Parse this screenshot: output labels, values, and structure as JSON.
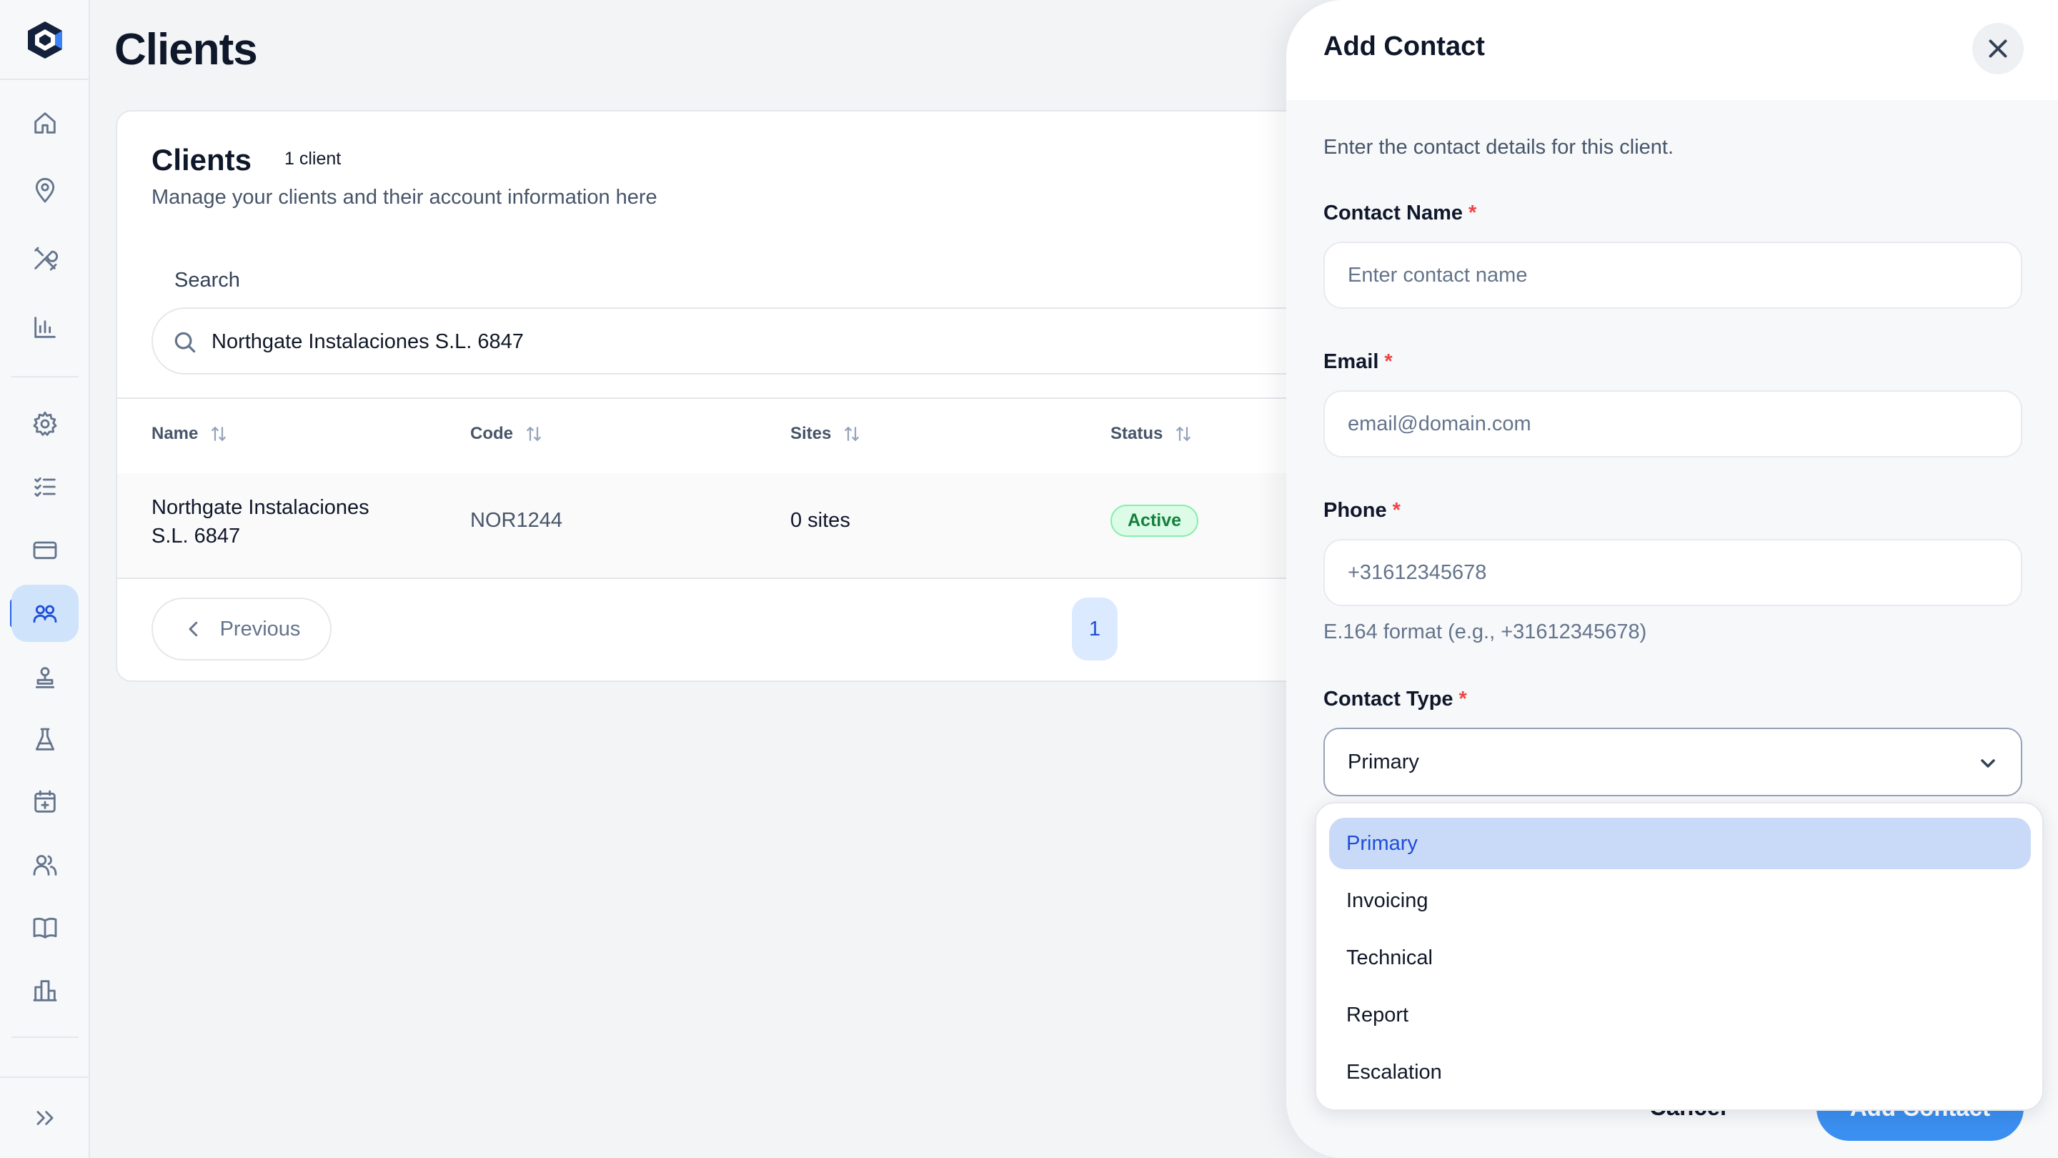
{
  "sidebar": {
    "icons": [
      "home-icon",
      "map-pin-icon",
      "tools-icon",
      "bar-chart-icon",
      "gear-icon",
      "checklist-icon",
      "credit-card-icon",
      "clients-icon",
      "stamp-icon",
      "flask-icon",
      "calendar-plus-icon",
      "users-icon",
      "book-icon",
      "buildings-icon",
      "expand-icon"
    ],
    "active": "clients-icon"
  },
  "page": {
    "title": "Clients"
  },
  "card": {
    "title": "Clients",
    "count": "1 client",
    "description": "Manage your clients and their account information here",
    "search_label": "Search",
    "search_value": "Northgate Instalaciones S.L. 6847"
  },
  "table": {
    "columns": [
      "Name",
      "Code",
      "Sites",
      "Status"
    ],
    "rows": [
      {
        "name": "Northgate Instalaciones S.L. 6847",
        "code": "NOR1244",
        "sites": "0 sites",
        "status": "Active"
      }
    ]
  },
  "pagination": {
    "previous": "Previous",
    "current": "1"
  },
  "drawer": {
    "title": "Add Contact",
    "description": "Enter the contact details for this client.",
    "fields": {
      "name": {
        "label": "Contact Name",
        "placeholder": "Enter contact name",
        "required": "*"
      },
      "email": {
        "label": "Email",
        "placeholder": "email@domain.com",
        "required": "*"
      },
      "phone": {
        "label": "Phone",
        "placeholder": "+31612345678",
        "required": "*",
        "helper": "E.164 format (e.g., +31612345678)"
      },
      "type": {
        "label": "Contact Type",
        "value": "Primary",
        "required": "*"
      }
    },
    "footer": {
      "cancel": "Cancel",
      "submit": "Add Contact"
    }
  },
  "dropdown": {
    "options": [
      "Primary",
      "Invoicing",
      "Technical",
      "Report",
      "Escalation"
    ],
    "selected": "Primary"
  },
  "colors": {
    "accent": "#2563eb",
    "active_nav_bg": "#cfe3fb",
    "status_active_bg": "#dcfce7",
    "status_active_text": "#15803d",
    "required": "#ef4444",
    "selected_option_bg": "#c9daf8",
    "primary_button": "#3b8ff0"
  }
}
